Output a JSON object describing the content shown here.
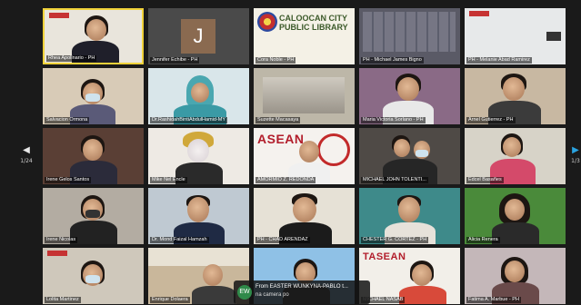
{
  "pager": {
    "left_page": "1/24",
    "right_page": "1/3"
  },
  "tiles": [
    {
      "name": "Rhea Apollnario - PH",
      "initial": ""
    },
    {
      "name": "Jennifer Echibe - PH",
      "initial": "J"
    },
    {
      "name": "Cora Noble - PH",
      "initial": "",
      "logo_text": "CALOOCAN CITY PUBLIC LIBRARY"
    },
    {
      "name": "PH - Michael James Bigno",
      "initial": ""
    },
    {
      "name": "PH - Melanie Abad Ramirez",
      "initial": ""
    },
    {
      "name": "Salvacion Ormona",
      "initial": ""
    },
    {
      "name": "Dr.RashidahBintiAbdulHamid-MY",
      "initial": ""
    },
    {
      "name": "Suzette Macasaya",
      "initial": ""
    },
    {
      "name": "Maria Victoria Sorlano - PH",
      "initial": ""
    },
    {
      "name": "Arnel Gutierrez - PH",
      "initial": ""
    },
    {
      "name": "Irene Gelos Santos",
      "initial": ""
    },
    {
      "name": "Mike Nel Encle",
      "initial": ""
    },
    {
      "name": "AMORMIO Z. REDONDA",
      "initial": "",
      "logo_text": "ASEAN"
    },
    {
      "name": "MICHAEL JOHN TOLENTI...",
      "initial": ""
    },
    {
      "name": "Edcel Basañes",
      "initial": ""
    },
    {
      "name": "Irene Nicolas",
      "initial": ""
    },
    {
      "name": "Dr. Mond Faizal Hamzah",
      "initial": ""
    },
    {
      "name": "PH - CHAD ARENDAZ",
      "initial": ""
    },
    {
      "name": "CHESTER G. CORTEZ - PH",
      "initial": ""
    },
    {
      "name": "Alicia Renera",
      "initial": ""
    },
    {
      "name": "Lolita Martinez",
      "initial": ""
    },
    {
      "name": "Enrique Dolaera",
      "initial": ""
    },
    {
      "name": "",
      "initial": ""
    },
    {
      "name": "MICHAEL NASAB",
      "initial": "",
      "logo_text": "TASEAN"
    },
    {
      "name": "Fatima A. Marbue - PH",
      "initial": ""
    }
  ],
  "chat": {
    "avatar": "EW",
    "from": "From EASTER WUNKYNA-PABLO t...",
    "message": "na camera po"
  },
  "colors": {
    "active_border": "#f0d23a",
    "background": "#1a1a1a"
  }
}
